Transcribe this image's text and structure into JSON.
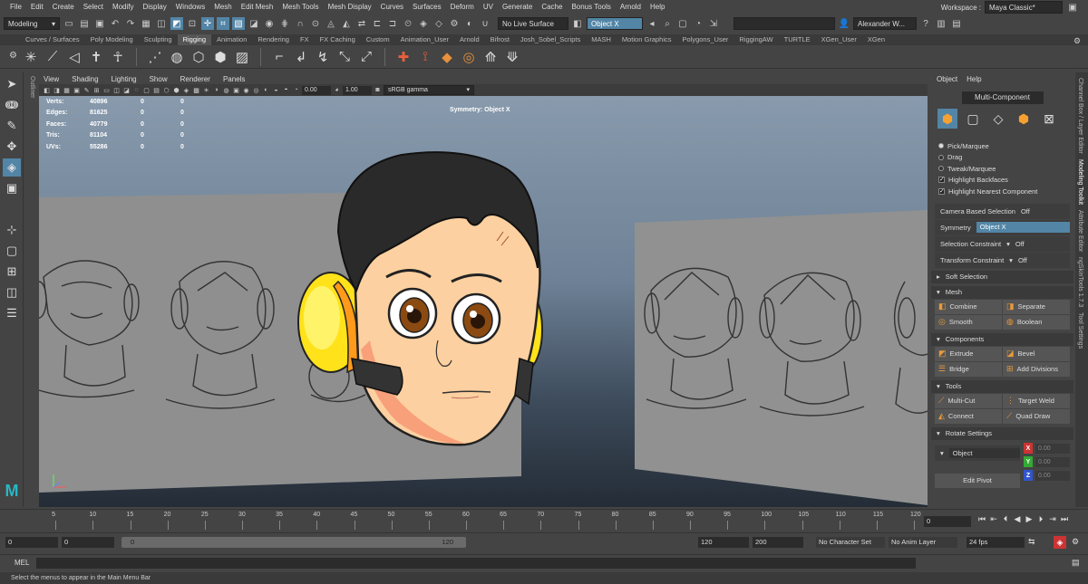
{
  "menubar": {
    "items": [
      "File",
      "Edit",
      "Create",
      "Select",
      "Modify",
      "Display",
      "Windows",
      "Mesh",
      "Edit Mesh",
      "Mesh Tools",
      "Mesh Display",
      "Curves",
      "Surfaces",
      "Deform",
      "UV",
      "Generate",
      "Cache",
      "Bonus Tools",
      "Arnold",
      "Help"
    ],
    "workspace_label": "Workspace :",
    "workspace_value": "Maya Classic*"
  },
  "statusline": {
    "mode": "Modeling",
    "live_surface": "No Live Surface",
    "object_field": "Object X",
    "user": "Alexander W..."
  },
  "shelf_tabs": [
    "Curves / Surfaces",
    "Poly Modeling",
    "Sculpting",
    "Rigging",
    "Animation",
    "Rendering",
    "FX",
    "FX Caching",
    "Custom",
    "Animation_User",
    "Arnold",
    "Bifrost",
    "Josh_Sobel_Scripts",
    "MASH",
    "Motion Graphics",
    "Polygons_User",
    "RiggingAW",
    "TURTLE",
    "XGen_User",
    "XGen"
  ],
  "active_shelf_tab": "Rigging",
  "outliner_label": "Outliner",
  "panel_menu": [
    "View",
    "Shading",
    "Lighting",
    "Show",
    "Renderer",
    "Panels"
  ],
  "panel_tools": {
    "exposure": "0.00",
    "gamma": "1.00",
    "color_space": "sRGB gamma"
  },
  "hud": {
    "rows": [
      {
        "label": "Verts:",
        "v1": "40896",
        "v2": "0",
        "v3": "0"
      },
      {
        "label": "Edges:",
        "v1": "81625",
        "v2": "0",
        "v3": "0"
      },
      {
        "label": "Faces:",
        "v1": "40779",
        "v2": "0",
        "v3": "0"
      },
      {
        "label": "Tris:",
        "v1": "81104",
        "v2": "0",
        "v3": "0"
      },
      {
        "label": "UVs:",
        "v1": "55286",
        "v2": "0",
        "v3": "0"
      }
    ],
    "symmetry": "Symmetry: Object X"
  },
  "modeling_toolkit": {
    "menu": [
      "Object",
      "Help"
    ],
    "mode_button": "Multi-Component",
    "pick_options": [
      {
        "label": "Pick/Marquee",
        "checked": true
      },
      {
        "label": "Drag",
        "checked": false
      },
      {
        "label": "Tweak/Marquee",
        "checked": false
      }
    ],
    "checks": [
      {
        "label": "Highlight Backfaces",
        "checked": true
      },
      {
        "label": "Highlight Nearest Component",
        "checked": true
      }
    ],
    "camera_based_selection": {
      "label": "Camera Based Selection",
      "value": "Off"
    },
    "symmetry": {
      "label": "Symmetry",
      "value": "Object X"
    },
    "selection_constraint": {
      "label": "Selection Constraint",
      "value": "Off"
    },
    "transform_constraint": {
      "label": "Transform Constraint",
      "value": "Off"
    },
    "soft_selection": "Soft Selection",
    "mesh_section": "Mesh",
    "mesh_buttons": [
      "Combine",
      "Separate",
      "Smooth",
      "Boolean"
    ],
    "components_section": "Components",
    "components_buttons": [
      "Extrude",
      "Bevel",
      "Bridge",
      "Add Divisions"
    ],
    "tools_section": "Tools",
    "tools_buttons": [
      "Multi-Cut",
      "Target Weld",
      "Connect",
      "Quad Draw"
    ],
    "rotate_section": "Rotate Settings",
    "rotate_space": "Object",
    "rotate_x": "0.00",
    "rotate_y": "0.00",
    "rotate_z": "0.00",
    "edit_pivot": "Edit Pivot"
  },
  "side_tabs": [
    "Channel Box / Layer Editor",
    "Modeling Toolkit",
    "Attribute Editor",
    "ngSkinTools 1.7.3",
    "Tool Settings"
  ],
  "timeline": {
    "ticks": [
      "5",
      "10",
      "15",
      "20",
      "25",
      "30",
      "35",
      "40",
      "45",
      "50",
      "55",
      "60",
      "65",
      "70",
      "75",
      "80",
      "85",
      "90",
      "95",
      "100",
      "105",
      "110",
      "115",
      "120"
    ],
    "current_frame": "0"
  },
  "range": {
    "start": "0",
    "playback_start": "0",
    "slider_start": "0",
    "slider_end": "120",
    "playback_end": "120",
    "end": "200",
    "character_set": "No Character Set",
    "anim_layer": "No Anim Layer",
    "fps": "24 fps"
  },
  "mel_label": "MEL",
  "help_line": "Select the menus to appear in the Main Menu Bar",
  "colors": {
    "accent": "#5285a6",
    "earmuff": "#ffe21a",
    "skin": "#fcd0a0",
    "hair": "#2a2a2a",
    "eye": "#8a4a12"
  }
}
